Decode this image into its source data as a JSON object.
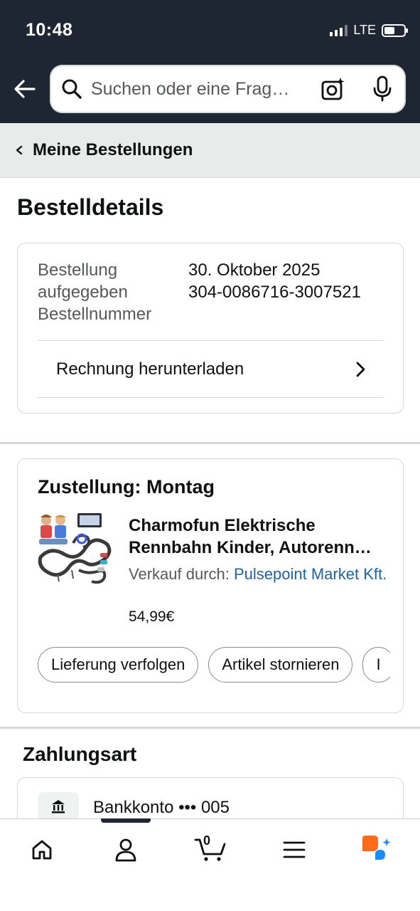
{
  "status_bar": {
    "time": "10:48",
    "network": "LTE"
  },
  "header": {
    "back_icon": "arrow-left-icon",
    "search": {
      "placeholder": "Suchen oder eine Frag…"
    }
  },
  "breadcrumb": {
    "label": "Meine Bestellungen"
  },
  "page": {
    "title": "Bestelldetails"
  },
  "order": {
    "placed_label": "Bestellung aufgegeben",
    "placed_value": "30. Oktober 2025",
    "number_label": "Bestellnummer",
    "number_value": "304-0086716-3007521",
    "invoice_label": "Rechnung herunterladen"
  },
  "delivery": {
    "title": "Zustellung: Montag",
    "product_name": "Charmofun Elektrische Rennbahn Kinder, Autorenn…",
    "sold_by_label": "Verkauf durch:",
    "seller": "Pulsepoint Market Kft.",
    "price": "54,99€",
    "buttons": [
      "Lieferung verfolgen",
      "Artikel stornieren",
      "I"
    ]
  },
  "payment": {
    "title": "Zahlungsart",
    "method": "Bankkonto ••• 005"
  },
  "bottom_nav": {
    "cart_count": "0",
    "items": [
      "home-icon",
      "account-icon",
      "cart-icon",
      "menu-icon",
      "rufus-icon"
    ]
  },
  "colors": {
    "header_bg": "#1f2633",
    "link": "#2162a1",
    "rufus_orange": "#ff6b1a",
    "rufus_blue": "#1a8cff"
  }
}
